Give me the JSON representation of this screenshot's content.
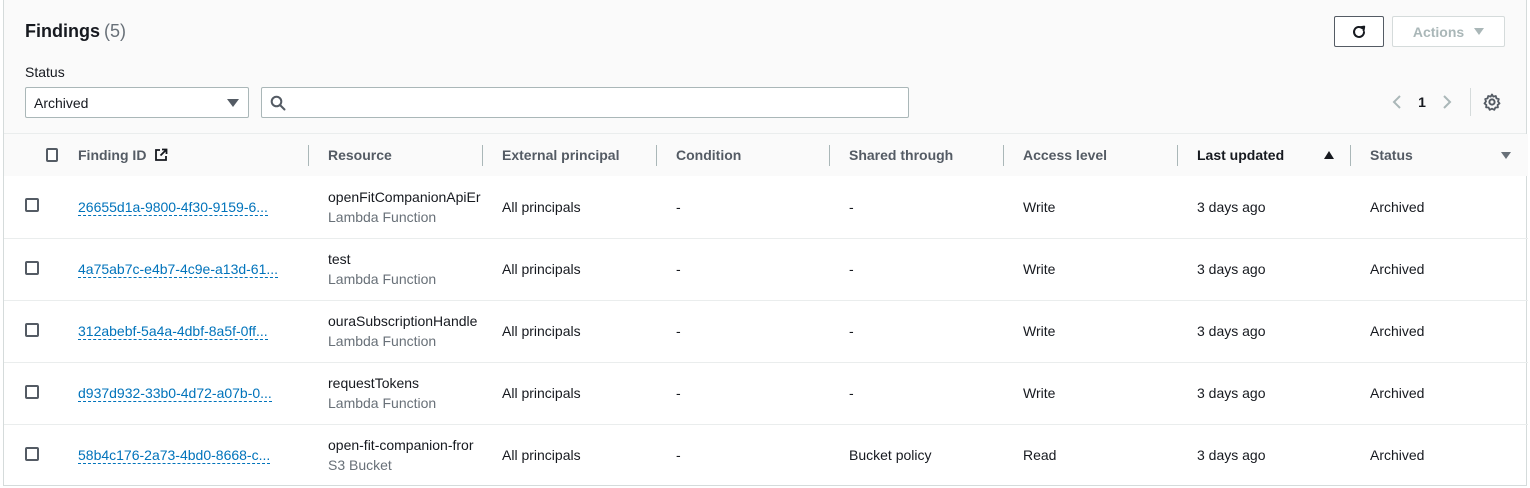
{
  "header": {
    "title": "Findings",
    "count": "(5)",
    "actions_label": "Actions",
    "refresh_icon": "refresh-icon"
  },
  "filter": {
    "status_label": "Status",
    "status_value": "Archived",
    "search_placeholder": ""
  },
  "pagination": {
    "current_page": "1"
  },
  "table": {
    "columns": {
      "finding_id": "Finding ID",
      "resource": "Resource",
      "external_principal": "External principal",
      "condition": "Condition",
      "shared_through": "Shared through",
      "access_level": "Access level",
      "last_updated": "Last updated",
      "status": "Status"
    },
    "sort": {
      "column": "last_updated",
      "direction": "ascending"
    },
    "rows": [
      {
        "finding_id": "26655d1a-9800-4f30-9159-6...",
        "resource_name": "openFitCompanionApiEr",
        "resource_type": "Lambda Function",
        "external_principal": "All principals",
        "condition": "-",
        "shared_through": "-",
        "access_level": "Write",
        "last_updated": "3 days ago",
        "status": "Archived"
      },
      {
        "finding_id": "4a75ab7c-e4b7-4c9e-a13d-61...",
        "resource_name": "test",
        "resource_type": "Lambda Function",
        "external_principal": "All principals",
        "condition": "-",
        "shared_through": "-",
        "access_level": "Write",
        "last_updated": "3 days ago",
        "status": "Archived"
      },
      {
        "finding_id": "312abebf-5a4a-4dbf-8a5f-0ff...",
        "resource_name": "ouraSubscriptionHandle",
        "resource_type": "Lambda Function",
        "external_principal": "All principals",
        "condition": "-",
        "shared_through": "-",
        "access_level": "Write",
        "last_updated": "3 days ago",
        "status": "Archived"
      },
      {
        "finding_id": "d937d932-33b0-4d72-a07b-0...",
        "resource_name": "requestTokens",
        "resource_type": "Lambda Function",
        "external_principal": "All principals",
        "condition": "-",
        "shared_through": "-",
        "access_level": "Write",
        "last_updated": "3 days ago",
        "status": "Archived"
      },
      {
        "finding_id": "58b4c176-2a73-4bd0-8668-c...",
        "resource_name": "open-fit-companion-fror",
        "resource_type": "S3 Bucket",
        "external_principal": "All principals",
        "condition": "-",
        "shared_through": "Bucket policy",
        "access_level": "Read",
        "last_updated": "3 days ago",
        "status": "Archived"
      }
    ]
  },
  "colors": {
    "link": "#0073bb",
    "text": "#16191f",
    "muted": "#687078",
    "border": "#d5dbdb"
  }
}
